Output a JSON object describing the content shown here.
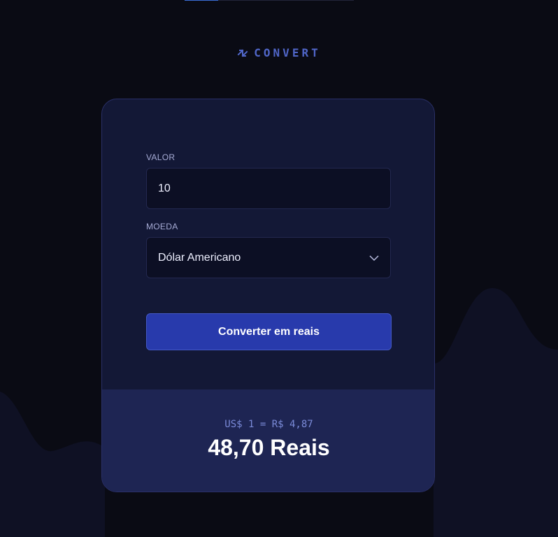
{
  "top_progress": {
    "value": 0.2
  },
  "logo": {
    "icon": "arrows-exchange-icon",
    "text": "CONVERT"
  },
  "form": {
    "amount": {
      "label": "VALOR",
      "value": "10"
    },
    "currency": {
      "label": "MOEDA",
      "selected": "Dólar Americano",
      "icon": "chevron-down-icon"
    },
    "submit_label": "Converter em reais"
  },
  "result": {
    "rate": "US$ 1 = R$ 4,87",
    "total": "48,70 Reais"
  },
  "colors": {
    "background": "#0a0b14",
    "card": "#131836",
    "result_panel": "#1e2553",
    "accent": "#283aac",
    "logo": "#5066c8"
  }
}
